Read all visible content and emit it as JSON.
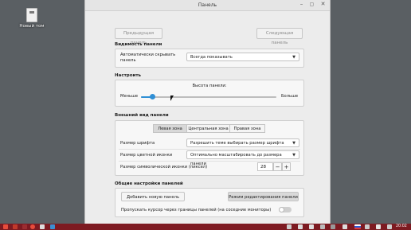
{
  "desktop": {
    "icon_label": "Новый том"
  },
  "window": {
    "title": "Панель",
    "min_glyph": "–",
    "max_glyph": "▢",
    "close_glyph": "✕"
  },
  "nav": {
    "prev": "Предыдущая панель",
    "next": "Следующая панель"
  },
  "visibility": {
    "title": "Видимость панели",
    "autohide_label": "Автоматически скрывать панель",
    "autohide_value": "Всегда показывать"
  },
  "customize": {
    "title": "Настроить",
    "slider_title": "Высота панели:",
    "less": "Меньше",
    "more": "Больше",
    "height_level": 0.08
  },
  "appearance": {
    "title": "Внешний вид панели",
    "zones": [
      "Левая зона",
      "Центральная зона",
      "Правая зона"
    ],
    "font_size_label": "Размер шрифта",
    "font_size_value": "Разрешить теме выбирать размер шрифта",
    "color_icon_label": "Размер цветной иконки",
    "color_icon_value": "Оптимально масштабировать до размера панели",
    "symbolic_icon_label": "Размер символической иконки (пиксел)",
    "symbolic_icon_value": "28",
    "minus": "−",
    "plus": "+"
  },
  "general": {
    "title": "Общие настройки панелей",
    "add_panel": "Добавить новую панель",
    "edit_mode": "Режим редактирования панели",
    "pass_cursor_label": "Пропускать курсор через границы панелей (на соседние мониторы)",
    "pass_cursor_on": false
  },
  "taskbar": {
    "clock": "20:02"
  },
  "colors": {
    "taskbar": "#7d1a21",
    "accent": "#2f8fd5"
  }
}
